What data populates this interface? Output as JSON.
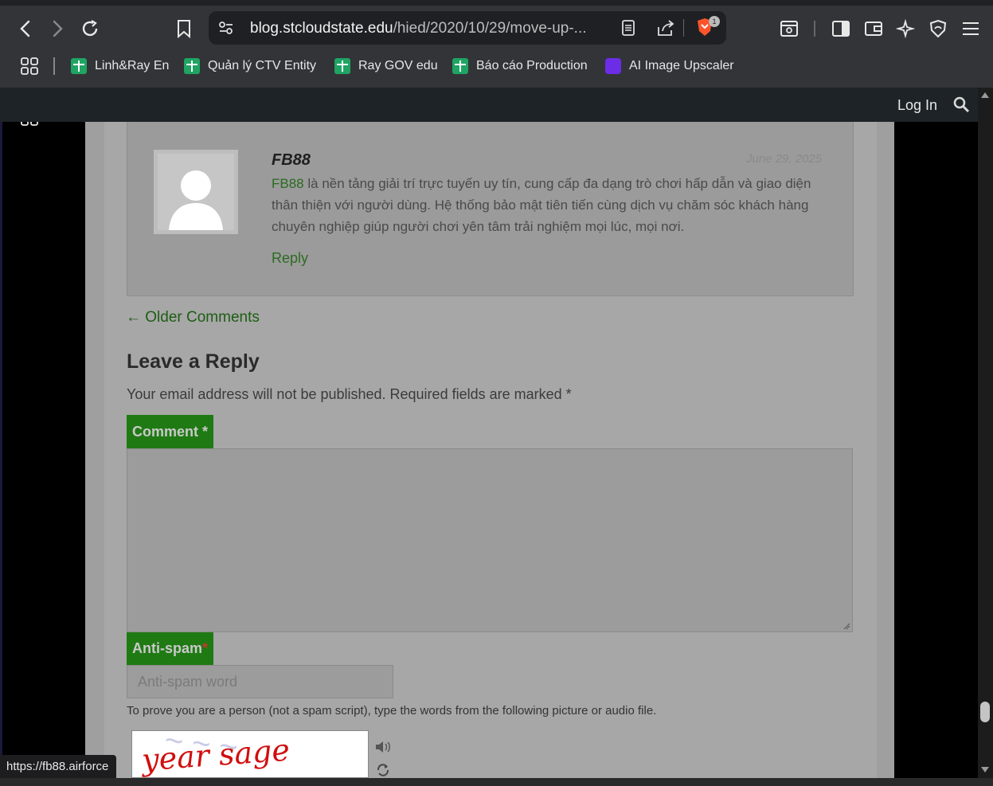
{
  "browser": {
    "url_host": "blog.stcloudstate.edu",
    "url_path": "/hied/2020/10/29/move-up-...",
    "brave_count": "1",
    "bookmarks": [
      {
        "label": "Linh&Ray En",
        "icon": "sheets-icon"
      },
      {
        "label": "Quản lý CTV Entity",
        "icon": "sheets-icon"
      },
      {
        "label": "Ray GOV edu",
        "icon": "sheets-icon"
      },
      {
        "label": "Báo cáo Production",
        "icon": "sheets-icon"
      },
      {
        "label": "AI Image Upscaler",
        "icon": "upscaler-icon"
      }
    ],
    "status_url": "https://fb88.airforce"
  },
  "site": {
    "login_label": "Log In"
  },
  "comment": {
    "author": "FB88",
    "date": "June 29, 2025",
    "link_text": "FB88",
    "body": " là nền tảng giải trí trực tuyến uy tín, cung cấp đa dạng trò chơi hấp dẫn và giao diện thân thiện với người dùng. Hệ thống bảo mật tiên tiến cùng dịch vụ chăm sóc khách hàng chuyên nghiệp giúp người chơi yên tâm trải nghiệm mọi lúc, mọi nơi.",
    "reply_label": "Reply"
  },
  "nav": {
    "older_comments": "← Older Comments"
  },
  "form": {
    "heading": "Leave a Reply",
    "notice": "Your email address will not be published. Required fields are marked",
    "required_mark": "*",
    "comment_label": "Comment",
    "antispam_label": "Anti-spam",
    "antispam_placeholder": "Anti-spam word",
    "prove_text": "To prove you are a person (not a spam script), type the words from the following picture or audio file.",
    "captcha_text": "year sage"
  },
  "colors": {
    "accent_green": "#1f7a13",
    "link_green": "#2d6b22"
  }
}
